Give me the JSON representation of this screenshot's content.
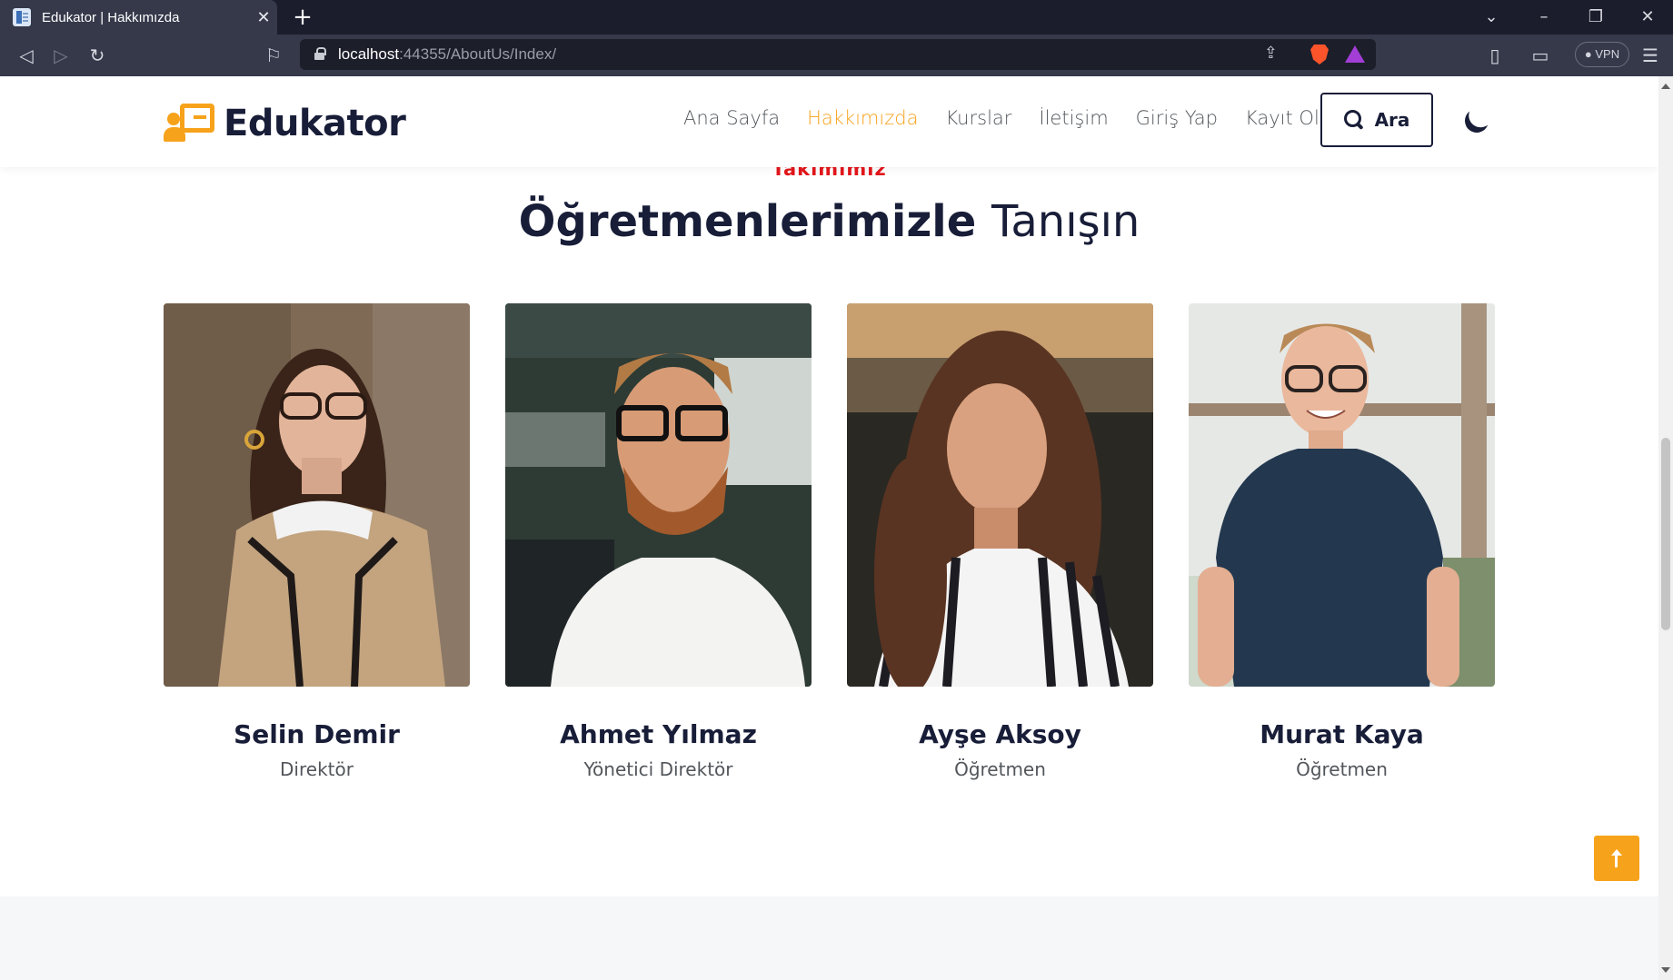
{
  "browser": {
    "tab_title": "Edukator | Hakkımızda",
    "tab_close": "✕",
    "new_tab": "+",
    "url_host": "localhost",
    "url_rest": ":44355/AboutUs/Index/",
    "vpn_label": "● VPN"
  },
  "site": {
    "logo_text": "Edukator",
    "nav": [
      {
        "label": "Ana Sayfa",
        "active": false
      },
      {
        "label": "Hakkımızda",
        "active": true
      },
      {
        "label": "Kurslar",
        "active": false
      },
      {
        "label": "İletişim",
        "active": false
      },
      {
        "label": "Giriş Yap",
        "active": false
      },
      {
        "label": "Kayıt Ol",
        "active": false
      }
    ],
    "search_label": "Ara"
  },
  "section": {
    "eyebrow": "Takımımız",
    "title_strong": "Öğretmenlerimizle",
    "title_light": "Tanışın"
  },
  "team": [
    {
      "name": "Selin Demir",
      "role": "Direktör"
    },
    {
      "name": "Ahmet Yılmaz",
      "role": "Yönetici Direktör"
    },
    {
      "name": "Ayşe Aksoy",
      "role": "Öğretmen"
    },
    {
      "name": "Murat Kaya",
      "role": "Öğretmen"
    }
  ],
  "colors": {
    "accent": "#f7a21b",
    "eyebrow": "#e3161b",
    "heading": "#181d38",
    "text": "#52565b"
  }
}
